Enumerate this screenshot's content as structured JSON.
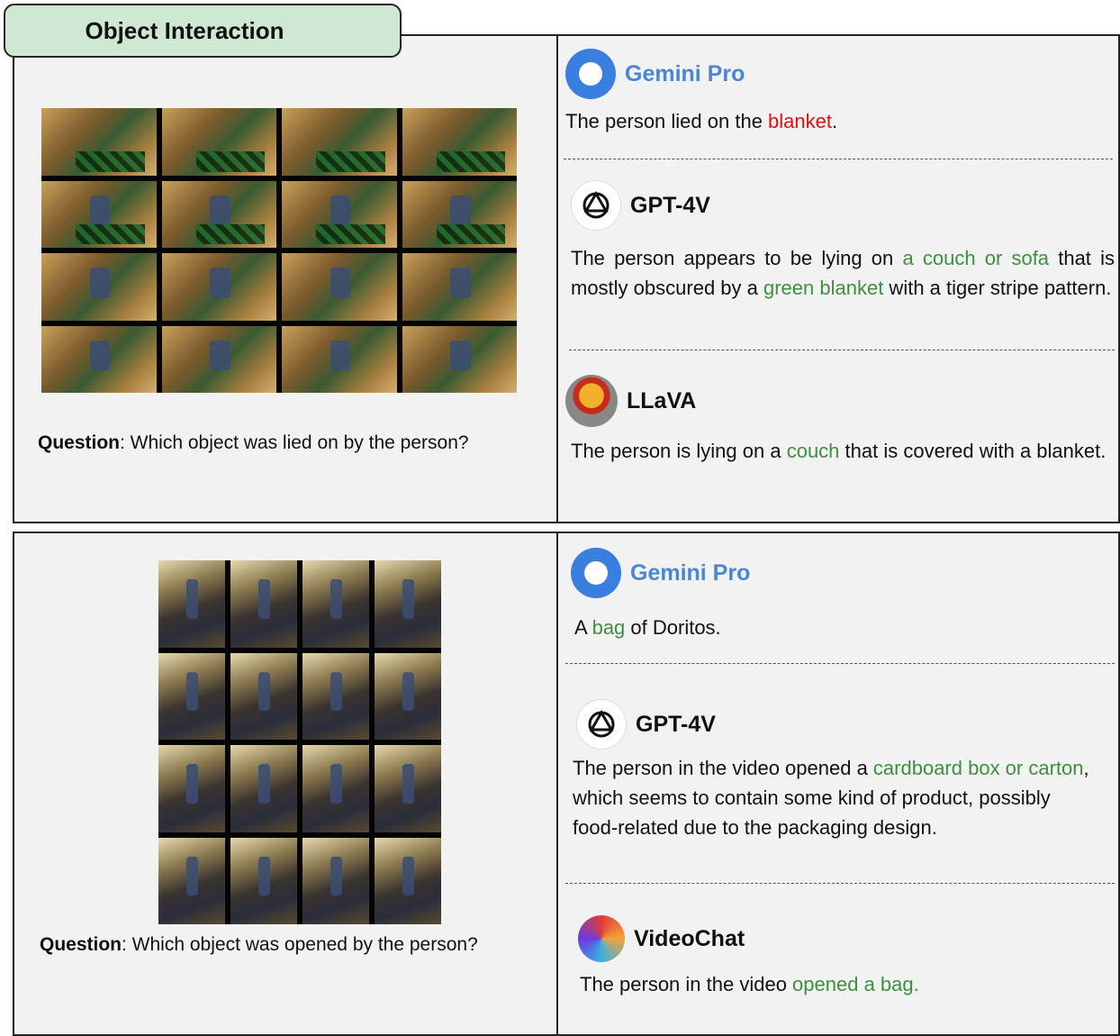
{
  "header": {
    "title": "Object Interaction"
  },
  "examples": [
    {
      "question_label": "Question",
      "question_text": ": Which object was lied on by the person?",
      "responses": [
        {
          "model": "Gemini Pro",
          "icon": "gemini-icon",
          "parts": [
            "The person lied on the ",
            "blanket",
            "."
          ]
        },
        {
          "model": "GPT-4V",
          "icon": "openai-icon",
          "parts": [
            "The person appears to be lying on ",
            "a couch or sofa",
            " that is mostly obscured by a ",
            "green blanket",
            " with a tiger stripe pattern."
          ]
        },
        {
          "model": "LLaVA",
          "icon": "llava-icon",
          "parts": [
            "The person is lying on a ",
            "couch",
            " that is covered with a blanket."
          ]
        }
      ]
    },
    {
      "question_label": "Question",
      "question_text": ": Which object was opened by the person?",
      "responses": [
        {
          "model": "Gemini Pro",
          "icon": "gemini-icon",
          "parts": [
            "A ",
            "bag",
            " of Doritos."
          ]
        },
        {
          "model": "GPT-4V",
          "icon": "openai-icon",
          "parts": [
            "The person in the video opened a ",
            "cardboard box or carton",
            ", which seems to contain some kind of product, possibly food-related due to the packaging design."
          ]
        },
        {
          "model": "VideoChat",
          "icon": "videochat-icon",
          "parts": [
            "The person in the video ",
            "opened a bag."
          ]
        }
      ]
    }
  ],
  "colors": {
    "correct": "#3f8f3f",
    "wrong": "#e01010",
    "gemini": "#4a86d6",
    "tab": "#cfe8d3"
  }
}
